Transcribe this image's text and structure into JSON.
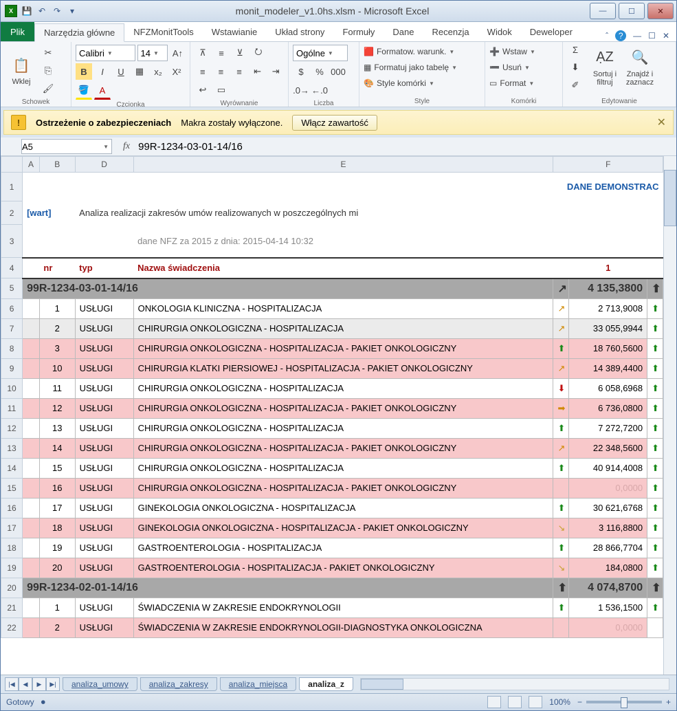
{
  "title": "monit_modeler_v1.0hs.xlsm - Microsoft Excel",
  "fileTab": "Plik",
  "ribbonTabs": [
    "Narzędzia główne",
    "NFZMonitTools",
    "Wstawianie",
    "Układ strony",
    "Formuły",
    "Dane",
    "Recenzja",
    "Widok",
    "Deweloper"
  ],
  "ribbon": {
    "schowek": {
      "label": "Schowek",
      "paste": "Wklej"
    },
    "czcionka": {
      "label": "Czcionka",
      "font": "Calibri",
      "size": "14"
    },
    "wyrownanie": {
      "label": "Wyrównanie"
    },
    "liczba": {
      "label": "Liczba",
      "format": "Ogólne"
    },
    "style": {
      "label": "Style",
      "i1": "Formatow. warunk.",
      "i2": "Formatuj jako tabelę",
      "i3": "Style komórki"
    },
    "komorki": {
      "label": "Komórki",
      "i1": "Wstaw",
      "i2": "Usuń",
      "i3": "Format"
    },
    "edytowanie": {
      "label": "Edytowanie",
      "i1": "Sortuj i filtruj",
      "i2": "Znajdź i zaznacz"
    }
  },
  "warn": {
    "bold": "Ostrzeżenie o zabezpieczeniach",
    "msg": "Makra zostały wyłączone.",
    "btn": "Włącz zawartość"
  },
  "namebox": "A5",
  "formula": "99R-1234-03-01-14/16",
  "cols": [
    "A",
    "B",
    "D",
    "E",
    "F"
  ],
  "r1_demo": "DANE DEMONSTRAC",
  "r2_wart": "[wart]",
  "r2_title": "Analiza realizacji zakresów umów realizowanych w poszczególnych mi",
  "r3_dane": "dane NFZ za 2015 z dnia: 2015-04-14 10:32",
  "hdr": {
    "nr": "nr",
    "typ": "typ",
    "nazwa": "Nazwa świadczenia",
    "col1": "1"
  },
  "rows": [
    {
      "rh": "5",
      "group": "99R-1234-03-01-14/16",
      "a1": "↗",
      "v": "4 135,3800",
      "a2": "⬆"
    },
    {
      "rh": "6",
      "nr": "1",
      "typ": "USŁUGI",
      "nazwa": "ONKOLOGIA KLINICZNA - HOSPITALIZACJA",
      "cls": "",
      "a1": "↗",
      "v": "2 713,9008",
      "a2": "⬆"
    },
    {
      "rh": "7",
      "nr": "2",
      "typ": "USŁUGI",
      "nazwa": "CHIRURGIA ONKOLOGICZNA - HOSPITALIZACJA",
      "cls": "grey",
      "a1": "↗",
      "v": "33 055,9944",
      "a2": "⬆"
    },
    {
      "rh": "8",
      "nr": "3",
      "typ": "USŁUGI",
      "nazwa": "CHIRURGIA ONKOLOGICZNA - HOSPITALIZACJA - PAKIET ONKOLOGICZNY",
      "cls": "pink",
      "a1": "⬆",
      "v": "18 760,5600",
      "a2": "⬆"
    },
    {
      "rh": "9",
      "nr": "10",
      "typ": "USŁUGI",
      "nazwa": "CHIRURGIA KLATKI PIERSIOWEJ - HOSPITALIZACJA - PAKIET ONKOLOGICZNY",
      "cls": "pink",
      "a1": "↗",
      "v": "14 389,4400",
      "a2": "⬆"
    },
    {
      "rh": "10",
      "nr": "11",
      "typ": "USŁUGI",
      "nazwa": "CHIRURGIA ONKOLOGICZNA - HOSPITALIZACJA",
      "cls": "",
      "a1": "⬇",
      "v": "6 058,6968",
      "a2": "⬆"
    },
    {
      "rh": "11",
      "nr": "12",
      "typ": "USŁUGI",
      "nazwa": "CHIRURGIA ONKOLOGICZNA - HOSPITALIZACJA - PAKIET ONKOLOGICZNY",
      "cls": "pink",
      "a1": "➡",
      "v": "6 736,0800",
      "a2": "⬆"
    },
    {
      "rh": "12",
      "nr": "13",
      "typ": "USŁUGI",
      "nazwa": "CHIRURGIA ONKOLOGICZNA - HOSPITALIZACJA",
      "cls": "",
      "a1": "⬆",
      "v": "7 272,7200",
      "a2": "⬆"
    },
    {
      "rh": "13",
      "nr": "14",
      "typ": "USŁUGI",
      "nazwa": "CHIRURGIA ONKOLOGICZNA - HOSPITALIZACJA - PAKIET ONKOLOGICZNY",
      "cls": "pink",
      "a1": "↗",
      "v": "22 348,5600",
      "a2": "⬆"
    },
    {
      "rh": "14",
      "nr": "15",
      "typ": "USŁUGI",
      "nazwa": "CHIRURGIA ONKOLOGICZNA - HOSPITALIZACJA",
      "cls": "",
      "a1": "⬆",
      "v": "40 914,4008",
      "a2": "⬆"
    },
    {
      "rh": "15",
      "nr": "16",
      "typ": "USŁUGI",
      "nazwa": "CHIRURGIA ONKOLOGICZNA - HOSPITALIZACJA - PAKIET ONKOLOGICZNY",
      "cls": "pink",
      "a1": "",
      "v": "0,0000",
      "a2": "⬆",
      "faded": true
    },
    {
      "rh": "16",
      "nr": "17",
      "typ": "USŁUGI",
      "nazwa": "GINEKOLOGIA ONKOLOGICZNA - HOSPITALIZACJA",
      "cls": "",
      "a1": "⬆",
      "v": "30 621,6768",
      "a2": "⬆"
    },
    {
      "rh": "17",
      "nr": "18",
      "typ": "USŁUGI",
      "nazwa": "GINEKOLOGIA ONKOLOGICZNA - HOSPITALIZACJA - PAKIET ONKOLOGICZNY",
      "cls": "pink",
      "a1": "↘",
      "v": "3 116,8800",
      "a2": "⬆"
    },
    {
      "rh": "18",
      "nr": "19",
      "typ": "USŁUGI",
      "nazwa": "GASTROENTEROLOGIA - HOSPITALIZACJA",
      "cls": "",
      "a1": "⬆",
      "v": "28 866,7704",
      "a2": "⬆"
    },
    {
      "rh": "19",
      "nr": "20",
      "typ": "USŁUGI",
      "nazwa": "GASTROENTEROLOGIA - HOSPITALIZACJA - PAKIET ONKOLOGICZNY",
      "cls": "pink",
      "a1": "↘",
      "v": "184,0800",
      "a2": "⬆"
    },
    {
      "rh": "20",
      "group": "99R-1234-02-01-14/16",
      "a1": "⬆",
      "v": "4 074,8700",
      "a2": "⬆"
    },
    {
      "rh": "21",
      "nr": "1",
      "typ": "USŁUGI",
      "nazwa": "ŚWIADCZENIA W ZAKRESIE ENDOKRYNOLOGII",
      "cls": "",
      "a1": "⬆",
      "v": "1 536,1500",
      "a2": "⬆"
    },
    {
      "rh": "22",
      "nr": "2",
      "typ": "USŁUGI",
      "nazwa": "ŚWIADCZENIA W ZAKRESIE ENDOKRYNOLOGII-DIAGNOSTYKA ONKOLOGICZNA",
      "cls": "pink",
      "a1": "",
      "v": "0,0000",
      "a2": "",
      "faded": true
    }
  ],
  "sheetTabs": [
    "analiza_umowy",
    "analiza_zakresy",
    "analiza_miejsca",
    "analiza_z"
  ],
  "status": "Gotowy",
  "zoom": "100%"
}
